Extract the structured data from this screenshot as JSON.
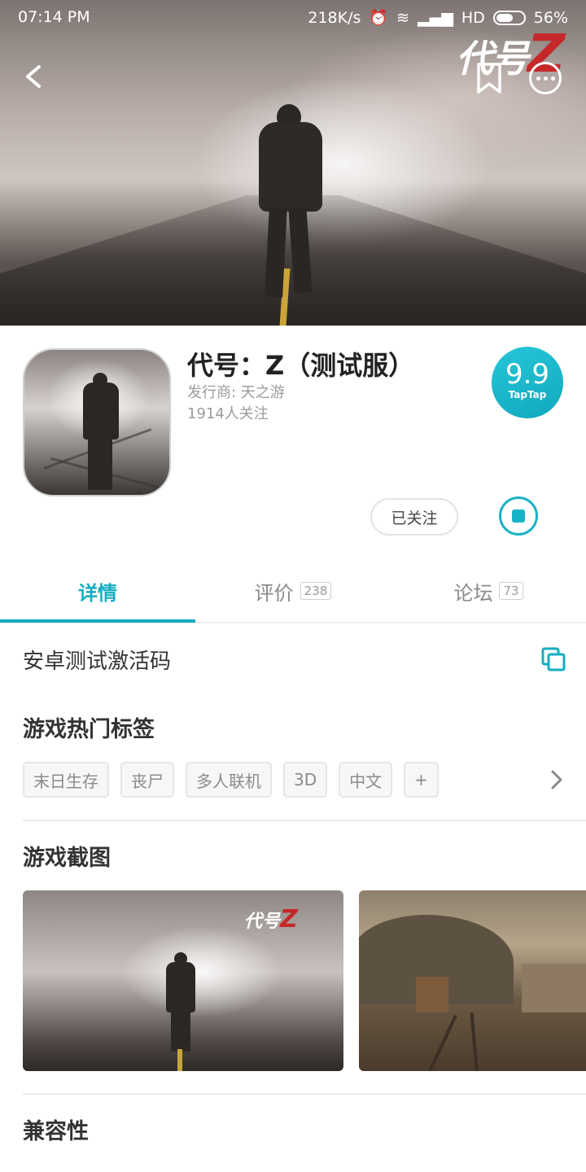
{
  "status_bar": {
    "time": "07:14 PM",
    "network_speed": "218K/s",
    "network_type": "HD",
    "battery": "56%"
  },
  "banner": {
    "logo_text": "代号",
    "logo_letter": "Z"
  },
  "app": {
    "title": "代号：Z（测试服）",
    "publisher": "发行商: 天之游",
    "followers": "1914人关注",
    "score": "9.9",
    "score_brand": "TapTap",
    "follow_label": "已关注"
  },
  "tabs": [
    {
      "label": "详情",
      "count": ""
    },
    {
      "label": "评价",
      "count": "238"
    },
    {
      "label": "论坛",
      "count": "73"
    }
  ],
  "activation": {
    "label": "安卓测试激活码"
  },
  "tags_section": {
    "title": "游戏热门标签",
    "tags": [
      "末日生存",
      "丧尸",
      "多人联机",
      "3D",
      "中文",
      "+"
    ]
  },
  "screenshots_section": {
    "title": "游戏截图",
    "mini_logo_text": "代号",
    "mini_logo_letter": "Z"
  },
  "compat_section": {
    "title": "兼容性"
  },
  "colors": {
    "accent": "#15aec1",
    "logo_red": "#c6282a"
  },
  "icons": {
    "back": "back-arrow-icon",
    "bookmark": "bookmark-icon",
    "more": "more-icon",
    "copy": "copy-icon",
    "chevron": "chevron-right-icon",
    "download": "download-stop-icon"
  }
}
